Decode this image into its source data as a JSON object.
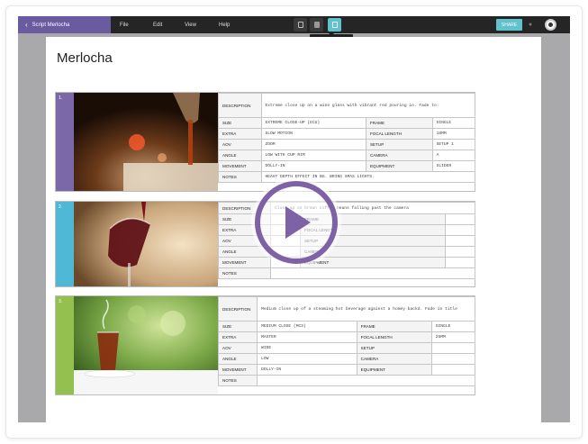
{
  "app": {
    "title": "Script Merlocha",
    "menu": [
      "File",
      "Edit",
      "View",
      "Help"
    ],
    "tooltip": "Shot List",
    "share_label": "SHARE"
  },
  "document": {
    "title": "Merlocha"
  },
  "labels": {
    "description": "DESCRIPTION",
    "size": "SIZE",
    "frame": "FRAME",
    "extra": "EXTRA",
    "focal": "FOCAL LENGTH",
    "aov": "AOV",
    "setup": "SETUP",
    "angle": "ANGLE",
    "camera": "CAMERA",
    "movement": "MOVEMENT",
    "equipment": "EQUIPMENT",
    "notes": "NOTES"
  },
  "shots": [
    {
      "number": "1.",
      "color": "#7a68a8",
      "description": "Extreme close up on a wine glass with vibrant red pouring in. Fade to:",
      "size": "EXTREME CLOSE-UP (ECU)",
      "frame": "SINGLE",
      "extra": "SLOW MOTION",
      "focal": "18MM",
      "aov": "ZOOM",
      "setup": "SETUP 1",
      "angle": "LOW WITH CUP RIM",
      "camera": "A",
      "movement": "DOLLY-IN",
      "equipment": "SLIDER",
      "notes": "HEAVY DEPTH EFFECT IN BG. BRING XMAS LIGHTS."
    },
    {
      "number": "2.",
      "color": "#4fb8d6",
      "description": "Close up on brown coffee beans falling past the camera",
      "size": "",
      "frame": "",
      "extra": "",
      "focal": "",
      "aov": "",
      "setup": "",
      "angle": "",
      "camera": "",
      "movement": "",
      "equipment": "",
      "notes": ""
    },
    {
      "number": "3.",
      "color": "#93c04f",
      "description": "Medium close up of a steaming hot beverage against a homey backd. Fade in title",
      "size": "MEDIUM CLOSE (MCS)",
      "frame": "SINGLE",
      "extra": "MASTER",
      "focal": "25MM",
      "aov": "WIDE",
      "setup": "",
      "angle": "LOW",
      "camera": "",
      "movement": "DOLLY-IN",
      "equipment": "",
      "notes": ""
    }
  ]
}
